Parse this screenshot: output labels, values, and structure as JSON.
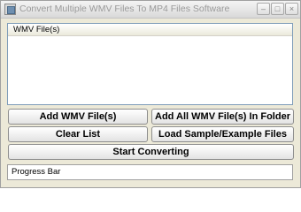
{
  "window": {
    "title": "Convert Multiple WMV Files To MP4 Files Software",
    "minimize_glyph": "–",
    "maximize_glyph": "□",
    "close_glyph": "×"
  },
  "file_list": {
    "column_header": "WMV File(s)",
    "items": []
  },
  "buttons": {
    "add_files": "Add WMV File(s)",
    "add_all_in_folder": "Add All WMV File(s) In Folder",
    "clear_list": "Clear List",
    "load_sample": "Load Sample/Example Files",
    "start_converting": "Start Converting"
  },
  "progress": {
    "label": "Progress Bar",
    "fraction": 0
  },
  "colors": {
    "window_background": "#ece9d8",
    "list_border": "#7f9db9",
    "title_text": "#9a9a9a"
  },
  "icons": {
    "app": "app-window-icon"
  }
}
